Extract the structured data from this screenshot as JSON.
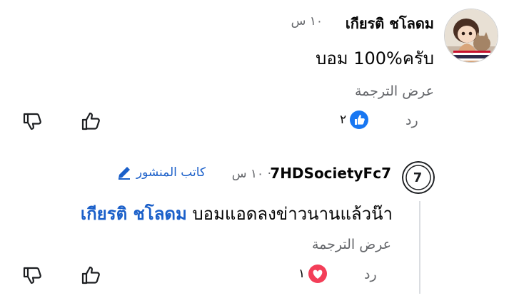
{
  "comment1": {
    "name": "เกียรติ ชโลดม",
    "time": "١٠ س",
    "text": "บอม 100%ครับ",
    "translate": "عرض الترجمة",
    "reply": "رد",
    "reaction_count": "٢",
    "reaction": "like-icon"
  },
  "comment2": {
    "name": "7HDSocietyFc7",
    "time": "١٠ س ·",
    "author_label": "كاتب المنشور",
    "mention": "เกียรติ ชโลดม",
    "text": " บอมแอดลงข่าวนานแล้วน๊า",
    "translate": "عرض الترجمة",
    "reply": "رد",
    "reaction_count": "١",
    "reaction": "love-icon"
  },
  "colors": {
    "like": "#1877f2",
    "love": "#f33e58",
    "link": "#1a5fc9",
    "muted": "#65676b"
  }
}
